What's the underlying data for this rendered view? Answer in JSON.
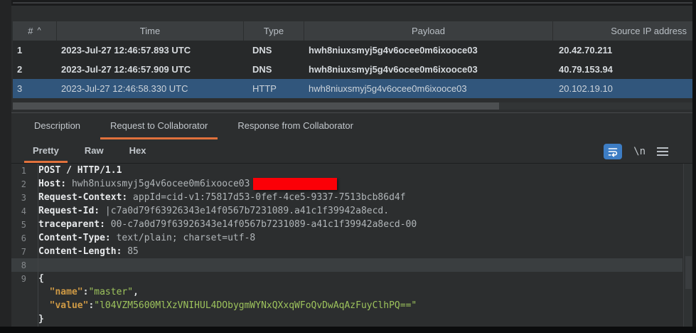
{
  "table": {
    "columns": [
      "#",
      "Time",
      "Type",
      "Payload",
      "Source IP address"
    ],
    "sort_indicator": "^",
    "rows": [
      {
        "num": "1",
        "time": "2023-Jul-27 12:46:57.893 UTC",
        "type": "DNS",
        "payload": "hwh8niuxsmyj5g4v6ocee0m6ixooce03",
        "ip": "20.42.70.211"
      },
      {
        "num": "2",
        "time": "2023-Jul-27 12:46:57.909 UTC",
        "type": "DNS",
        "payload": "hwh8niuxsmyj5g4v6ocee0m6ixooce03",
        "ip": "40.79.153.94"
      },
      {
        "num": "3",
        "time": "2023-Jul-27 12:46:58.330 UTC",
        "type": "HTTP",
        "payload": "hwh8niuxsmyj5g4v6ocee0m6ixooce03",
        "ip": "20.102.19.10"
      }
    ]
  },
  "tabs": {
    "description": "Description",
    "request": "Request to Collaborator",
    "response": "Response from Collaborator"
  },
  "subtabs": {
    "pretty": "Pretty",
    "raw": "Raw",
    "hex": "Hex"
  },
  "toolbar": {
    "newline_icon_label": "\\n"
  },
  "colors": {
    "accent_orange": "#e0713c",
    "selection_blue": "#31567c",
    "wrap_button_blue": "#3d7dc4",
    "redaction_red": "#fb0007"
  },
  "request": {
    "lines": {
      "l1": {
        "num": "1",
        "text": "POST / HTTP/1.1"
      },
      "l2": {
        "num": "2",
        "name": "Host:",
        "value": " hwh8niuxsmyj5g4v6ocee0m6ixooce03"
      },
      "l3": {
        "num": "3",
        "name": "Request-Context:",
        "value": " appId=cid-v1:75817d53-0fef-4ce5-9337-7513bcb86d4f"
      },
      "l4": {
        "num": "4",
        "name": "Request-Id:",
        "value": " |c7a0d79f63926343e14f0567b7231089.a41c1f39942a8ecd."
      },
      "l5": {
        "num": "5",
        "name": "traceparent:",
        "value": " 00-c7a0d79f63926343e14f0567b7231089-a41c1f39942a8ecd-00"
      },
      "l6": {
        "num": "6",
        "name": "Content-Type:",
        "value": " text/plain; charset=utf-8"
      },
      "l7": {
        "num": "7",
        "name": "Content-Length:",
        "value": " 85"
      },
      "l8": {
        "num": "8"
      },
      "l9": {
        "num": "9",
        "text": "{"
      },
      "l10": {
        "indent": "  ",
        "key": "\"name\"",
        "sep": ":",
        "str": "\"master\"",
        "comma": ","
      },
      "l11": {
        "indent": "  ",
        "key": "\"value\"",
        "sep": ":",
        "str": "\"l04VZM5600MlXzVNIHUL4DObygmWYNxQXxqWFoQvDwAqAzFuyClhPQ==\""
      },
      "l12": {
        "text": "}"
      }
    }
  }
}
